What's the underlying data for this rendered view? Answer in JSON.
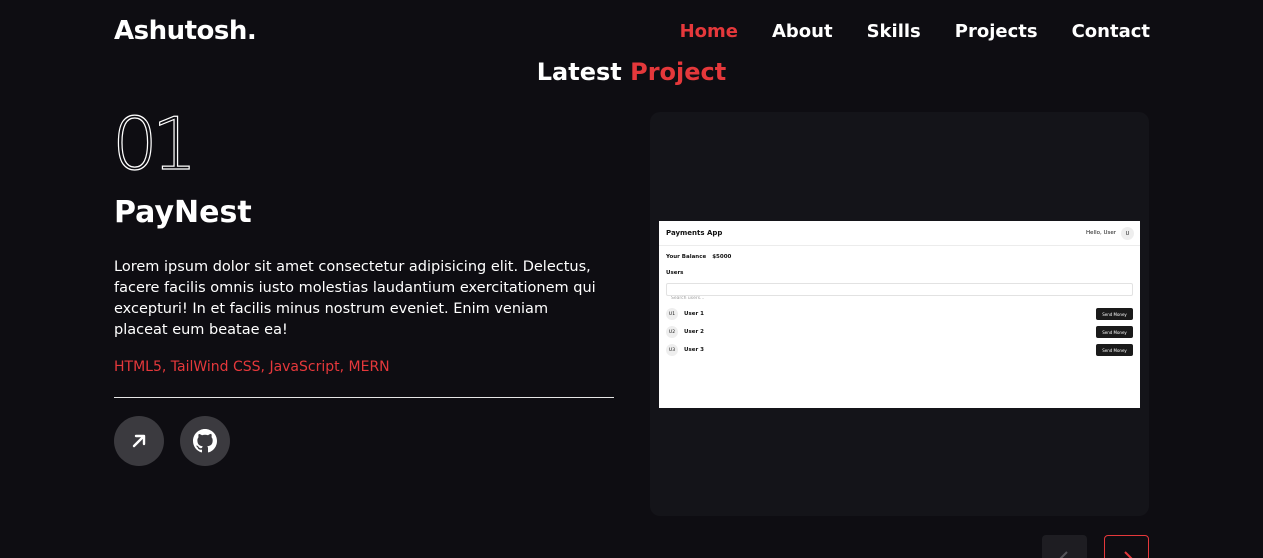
{
  "brand": {
    "logo": "Ashutosh."
  },
  "nav": {
    "items": [
      {
        "label": "Home",
        "active": true
      },
      {
        "label": "About",
        "active": false
      },
      {
        "label": "Skills",
        "active": false
      },
      {
        "label": "Projects",
        "active": false
      },
      {
        "label": "Contact",
        "active": false
      }
    ]
  },
  "section": {
    "title_main": "Latest",
    "title_accent": "Project"
  },
  "project": {
    "number": "01",
    "name": "PayNest",
    "description": "Lorem ipsum dolor sit amet consectetur adipisicing elit. Delectus, facere facilis omnis iusto molestias laudantium exercitationem qui excepturi! In et facilis minus nostrum eveniet. Enim veniam placeat eum beatae ea!",
    "tech": "HTML5, TailWind CSS, JavaScript, MERN",
    "buttons": {
      "live_icon": "arrow-up-right-icon",
      "github_icon": "github-icon"
    }
  },
  "preview": {
    "app_title": "Payments App",
    "greeting": "Hello, User",
    "avatar": "U",
    "balance_label": "Your Balance",
    "balance_value": "$5000",
    "users_heading": "Users",
    "search_placeholder": "Search users...",
    "users": [
      {
        "initials": "U1",
        "name": "User 1",
        "action": "Send Money"
      },
      {
        "initials": "U2",
        "name": "User 2",
        "action": "Send Money"
      },
      {
        "initials": "U3",
        "name": "User 3",
        "action": "Send Money"
      }
    ]
  },
  "slider": {
    "prev_icon": "chevron-left-icon",
    "next_icon": "chevron-right-icon"
  },
  "colors": {
    "accent": "#e5383b",
    "background": "#0e0d12",
    "card": "#141419",
    "button": "#3b3a3f"
  }
}
